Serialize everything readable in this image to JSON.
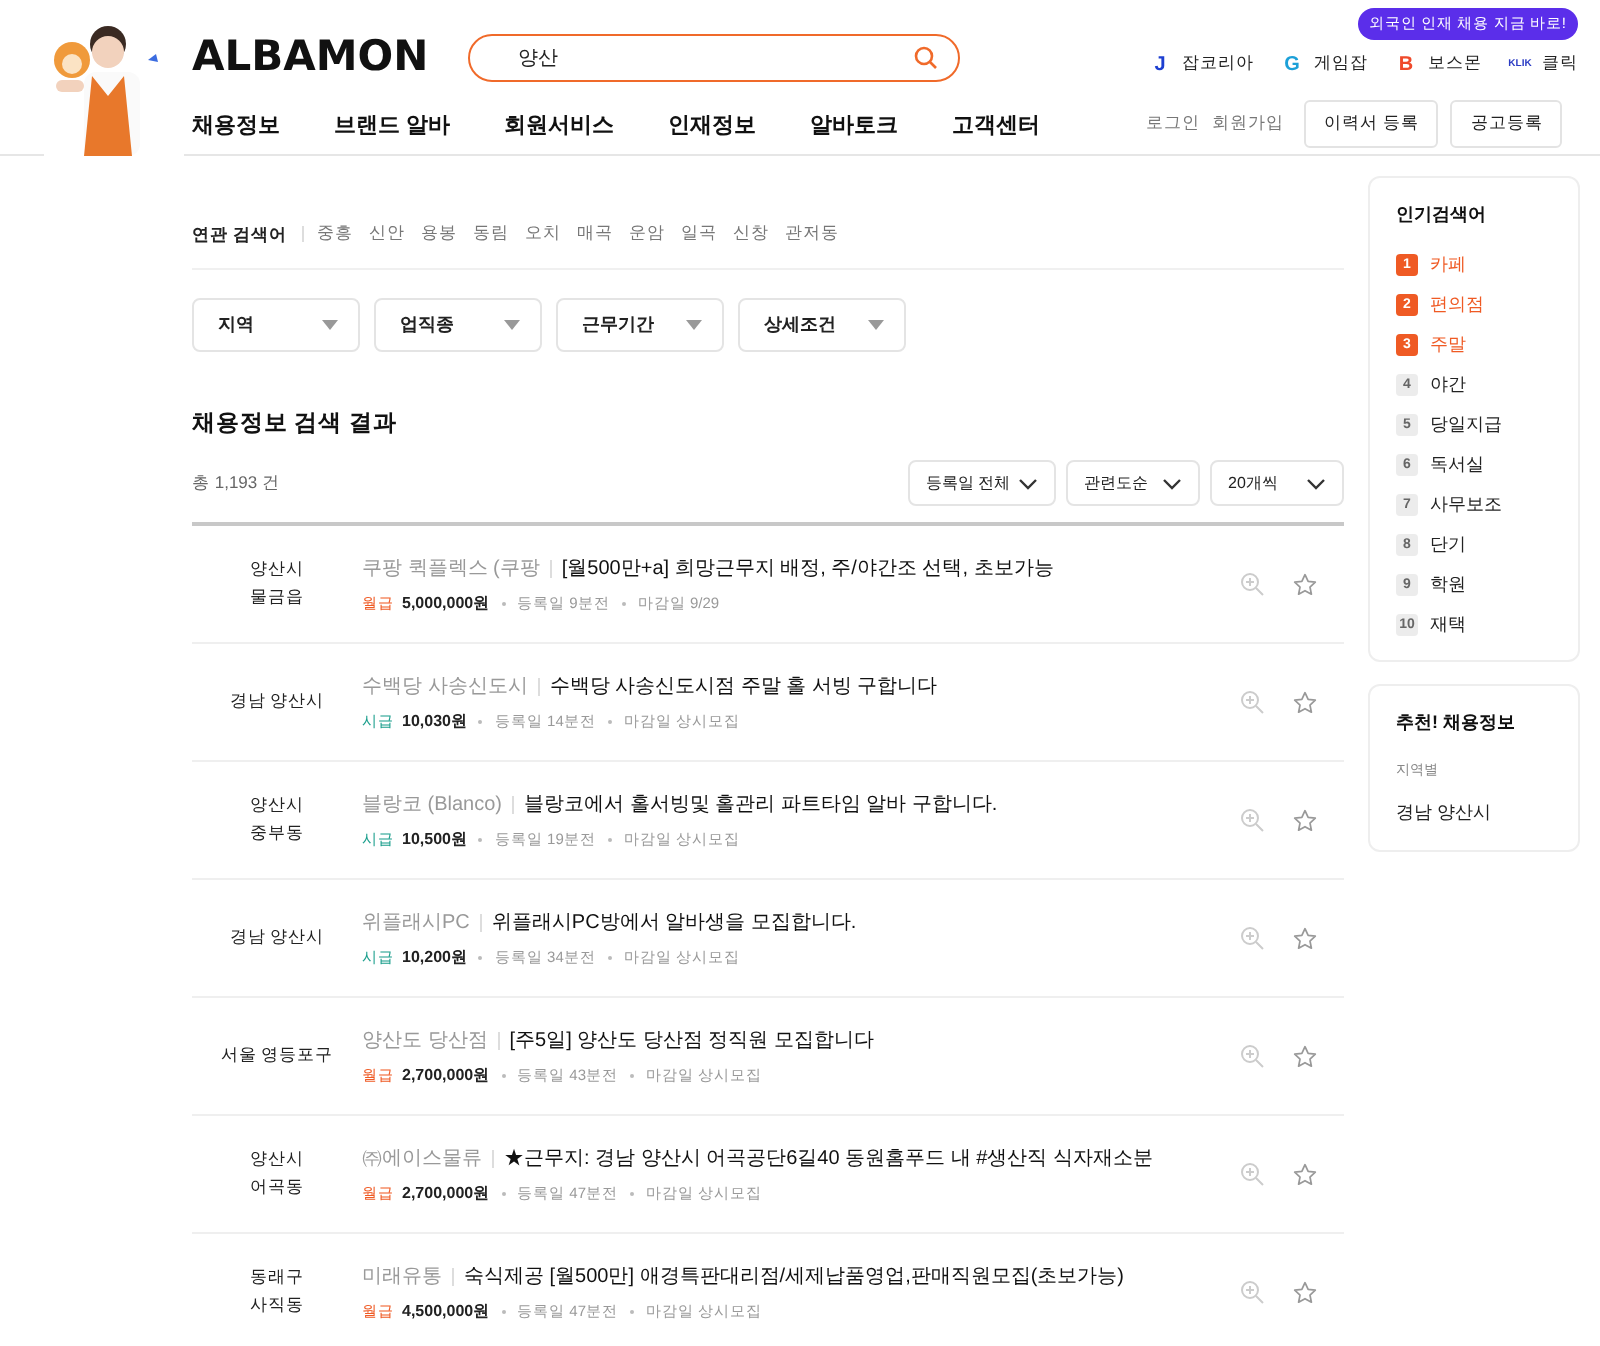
{
  "banner": {
    "text": "외국인 인재 채용 지금 바로!"
  },
  "logo": "ALBAMON",
  "search": {
    "value": "양산"
  },
  "family_sites": [
    {
      "kind": "j",
      "icon_text": "J",
      "label": "잡코리아"
    },
    {
      "kind": "g",
      "icon_text": "G",
      "label": "게임잡"
    },
    {
      "kind": "b",
      "icon_text": "B",
      "label": "보스몬"
    },
    {
      "kind": "k",
      "icon_text": "KLIK",
      "label": "클릭"
    }
  ],
  "nav": [
    "채용정보",
    "브랜드 알바",
    "회원서비스",
    "인재정보",
    "알바토크",
    "고객센터"
  ],
  "auth_links": [
    "로그인",
    "회원가입"
  ],
  "header_buttons": [
    "이력서 등록",
    "공고등록"
  ],
  "related": {
    "label": "연관 검색어",
    "terms": [
      "중흥",
      "신안",
      "용봉",
      "동림",
      "오치",
      "매곡",
      "운암",
      "일곡",
      "신창",
      "관저동"
    ]
  },
  "filters": [
    "지역",
    "업직종",
    "근무기간",
    "상세조건"
  ],
  "results": {
    "title": "채용정보 검색 결과",
    "count": "총 1,193 건",
    "sorts": [
      "등록일 전체",
      "관련도순",
      "20개씩"
    ]
  },
  "jobs": [
    {
      "location": [
        "양산시",
        "물금읍"
      ],
      "company": "쿠팡 퀵플렉스 (쿠팡",
      "title": "[월500만+a] 희망근무지 배정, 주/야간조 선택, 초보가능",
      "kind": "monthly",
      "pay_type": "월급",
      "pay": "5,000,000원",
      "posted": "등록일 9분전",
      "deadline": "마감일 9/29"
    },
    {
      "location": [
        "경남 양산시"
      ],
      "company": "수백당 사송신도시",
      "title": "수백당 사송신도시점 주말 홀 서빙 구합니다",
      "kind": "hourly",
      "pay_type": "시급",
      "pay": "10,030원",
      "posted": "등록일 14분전",
      "deadline": "마감일 상시모집"
    },
    {
      "location": [
        "양산시",
        "중부동"
      ],
      "company": "블랑코 (Blanco)",
      "title": "블랑코에서 홀서빙및 홀관리 파트타임 알바 구합니다.",
      "kind": "hourly",
      "pay_type": "시급",
      "pay": "10,500원",
      "posted": "등록일 19분전",
      "deadline": "마감일 상시모집"
    },
    {
      "location": [
        "경남 양산시"
      ],
      "company": "위플래시PC",
      "title": "위플래시PC방에서 알바생을 모집합니다.",
      "kind": "hourly",
      "pay_type": "시급",
      "pay": "10,200원",
      "posted": "등록일 34분전",
      "deadline": "마감일 상시모집"
    },
    {
      "location": [
        "서울 영등포구"
      ],
      "company": "양산도 당산점",
      "title": "[주5일] 양산도 당산점 정직원 모집합니다",
      "kind": "monthly",
      "pay_type": "월급",
      "pay": "2,700,000원",
      "posted": "등록일 43분전",
      "deadline": "마감일 상시모집"
    },
    {
      "location": [
        "양산시",
        "어곡동"
      ],
      "company": "㈜에이스물류",
      "title": "★근무지: 경남 양산시 어곡공단6길40 동원홈푸드 내 #생산직 식자재소분",
      "kind": "monthly",
      "pay_type": "월급",
      "pay": "2,700,000원",
      "posted": "등록일 47분전",
      "deadline": "마감일 상시모집"
    },
    {
      "location": [
        "동래구",
        "사직동"
      ],
      "company": "미래유통",
      "title": "숙식제공 [월500만] 애경특판대리점/세제납품영업,판매직원모집(초보가능)",
      "kind": "monthly",
      "pay_type": "월급",
      "pay": "4,500,000원",
      "posted": "등록일 47분전",
      "deadline": "마감일 상시모집"
    }
  ],
  "popular": {
    "title": "인기검색어",
    "items": [
      {
        "rank": "1",
        "label": "카페",
        "top": true
      },
      {
        "rank": "2",
        "label": "편의점",
        "top": true
      },
      {
        "rank": "3",
        "label": "주말",
        "top": true
      },
      {
        "rank": "4",
        "label": "야간",
        "top": false
      },
      {
        "rank": "5",
        "label": "당일지급",
        "top": false
      },
      {
        "rank": "6",
        "label": "독서실",
        "top": false
      },
      {
        "rank": "7",
        "label": "사무보조",
        "top": false
      },
      {
        "rank": "8",
        "label": "단기",
        "top": false
      },
      {
        "rank": "9",
        "label": "학원",
        "top": false
      },
      {
        "rank": "10",
        "label": "재택",
        "top": false
      }
    ]
  },
  "recommend": {
    "title": "추천! 채용정보",
    "label": "지역별",
    "value": "경남 양산시"
  }
}
